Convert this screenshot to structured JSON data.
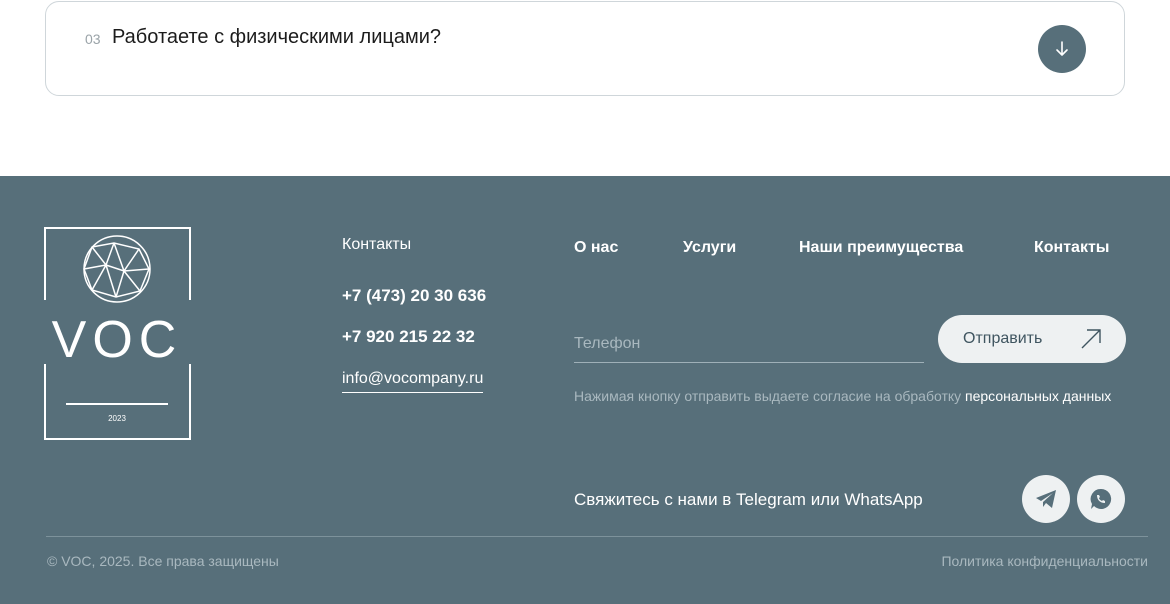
{
  "faq": {
    "number": "03",
    "question": "Работаете с физическими лицами?"
  },
  "logo": {
    "text": "VOC",
    "year": "2023"
  },
  "contacts": {
    "title": "Контакты",
    "phone1": "+7 (473) 20 30 636",
    "phone2": "+7 920 215 22 32",
    "email": "info@vocompany.ru"
  },
  "nav": {
    "items": [
      "О нас",
      "Услуги",
      "Наши преимущества",
      "Контакты"
    ]
  },
  "form": {
    "phone_placeholder": "Телефон",
    "send_label": "Отправить",
    "consent_text": "Нажимая кнопку отправить выдаете согласие на обработку ",
    "consent_link": "персональных данных"
  },
  "social": {
    "connect_text": "Свяжитесь с нами в Telegram или WhatsApp",
    "icons": [
      "telegram-icon",
      "whatsapp-icon"
    ]
  },
  "bottom": {
    "copyright": "© VOC, 2025. Все права защищены",
    "privacy": "Политика конфиденциальности"
  },
  "colors": {
    "footer_bg": "#576f7a",
    "button_bg": "#eef1f2",
    "muted_text": "#a9b8bf"
  }
}
